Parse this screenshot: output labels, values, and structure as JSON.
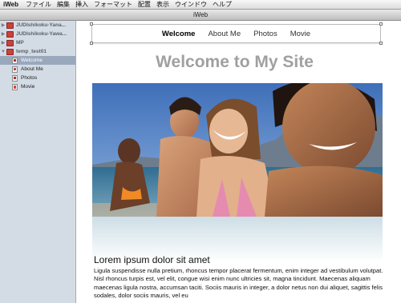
{
  "menubar": {
    "app": "iWeb",
    "items": [
      "ファイル",
      "編集",
      "挿入",
      "フォーマット",
      "配置",
      "表示",
      "ウインドウ",
      "ヘルプ"
    ]
  },
  "window": {
    "title": "iWeb"
  },
  "sidebar": {
    "sites": [
      {
        "label": "JUDIshikoku-Yana...",
        "expanded": false
      },
      {
        "label": "JUDIshikoku-Yawa...",
        "expanded": false
      },
      {
        "label": "MP",
        "expanded": false
      },
      {
        "label": "temp_test01",
        "expanded": true
      }
    ],
    "pages": [
      {
        "label": "Welcome",
        "selected": true,
        "icon": "welcome-page-icon"
      },
      {
        "label": "About Me",
        "selected": false,
        "icon": "about-page-icon"
      },
      {
        "label": "Photos",
        "selected": false,
        "icon": "photos-page-icon"
      },
      {
        "label": "Movie",
        "selected": false,
        "icon": "movie-page-icon"
      }
    ]
  },
  "page": {
    "nav": [
      "Welcome",
      "About Me",
      "Photos",
      "Movie"
    ],
    "active_nav": "Welcome",
    "title": "Welcome to My Site",
    "heading": "Lorem ipsum dolor sit amet",
    "body": "Ligula suspendisse nulla pretium, rhoncus tempor placerat fermentum, enim integer ad vestibulum volutpat. Nisl rhoncus turpis est, vel elit, congue wisi enim nunc ultricies sit, magna tincidunt. Maecenas aliquam maecenas ligula nostra, accumsan taciti. Sociis mauris in integer, a dolor netus non dui aliquet, sagittis felis sodales, dolor sociis mauris, vel eu"
  },
  "colors": {
    "sidebar_bg": "#d3dbe5",
    "sidebar_selected": "#9aa8bd",
    "title_gray": "#a0a0a0",
    "site_icon_red": "#c9423b"
  }
}
